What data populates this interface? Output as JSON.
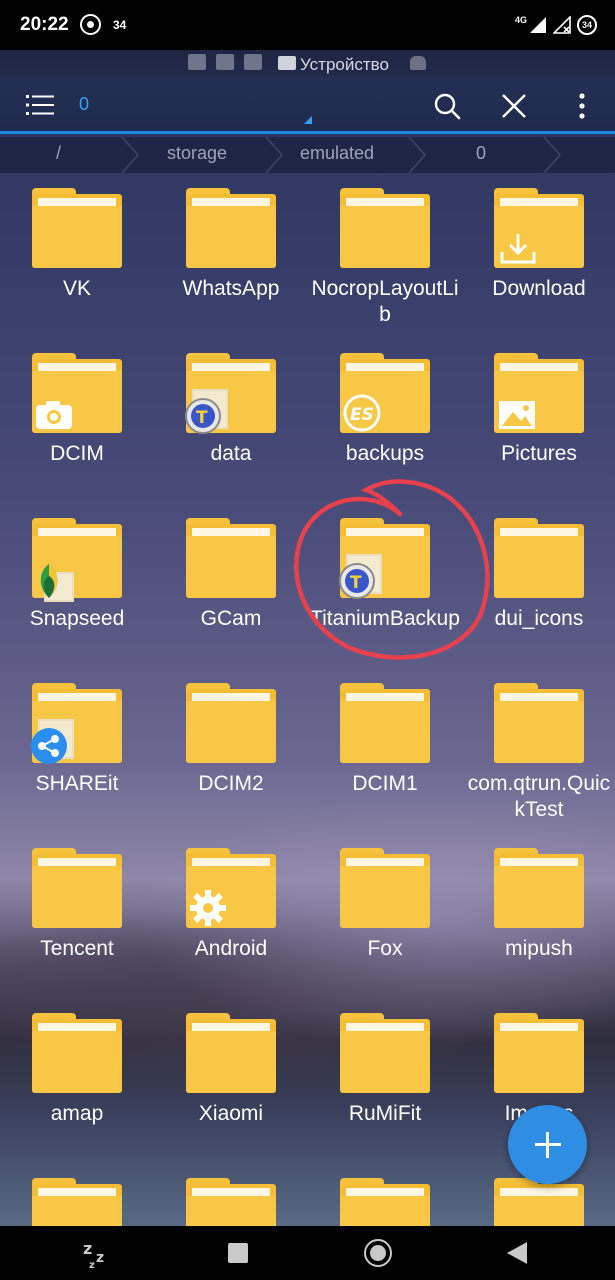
{
  "status_bar": {
    "time": "20:22",
    "notification_count": "34",
    "network": "4G",
    "battery": "34"
  },
  "location_strip": {
    "label": "Устройство"
  },
  "toolbar": {
    "selection_count": "0"
  },
  "breadcrumb": [
    "/",
    "storage",
    "emulated",
    "0"
  ],
  "items": [
    {
      "name": "VK",
      "badge": ""
    },
    {
      "name": "WhatsApp",
      "badge": ""
    },
    {
      "name": "NocropLayoutLib",
      "badge": ""
    },
    {
      "name": "Download",
      "badge": "download-icon"
    },
    {
      "name": "DCIM",
      "badge": "camera-icon"
    },
    {
      "name": "data",
      "badge": "titanium-icon"
    },
    {
      "name": "backups",
      "badge": "es-icon"
    },
    {
      "name": "Pictures",
      "badge": "picture-icon"
    },
    {
      "name": "Snapseed",
      "badge": "snapseed-icon"
    },
    {
      "name": "GCam",
      "badge": ""
    },
    {
      "name": "TitaniumBackup",
      "badge": "titanium-icon"
    },
    {
      "name": "dui_icons",
      "badge": ""
    },
    {
      "name": "SHAREit",
      "badge": "shareit-icon"
    },
    {
      "name": "DCIM2",
      "badge": ""
    },
    {
      "name": "DCIM1",
      "badge": ""
    },
    {
      "name": "com.qtrun.QuickTest",
      "badge": ""
    },
    {
      "name": "Tencent",
      "badge": ""
    },
    {
      "name": "Android",
      "badge": "gear-icon"
    },
    {
      "name": "Fox",
      "badge": ""
    },
    {
      "name": "mipush",
      "badge": ""
    },
    {
      "name": "amap",
      "badge": ""
    },
    {
      "name": "Xiaomi",
      "badge": ""
    },
    {
      "name": "RuMiFit",
      "badge": ""
    },
    {
      "name": "Images",
      "badge": ""
    },
    {
      "name": "",
      "badge": ""
    },
    {
      "name": "",
      "badge": ""
    },
    {
      "name": "",
      "badge": ""
    },
    {
      "name": "",
      "badge": ""
    }
  ],
  "colors": {
    "folder": "#f7c745",
    "accent": "#2f8de4",
    "highlight_ring": "#e8414e"
  }
}
